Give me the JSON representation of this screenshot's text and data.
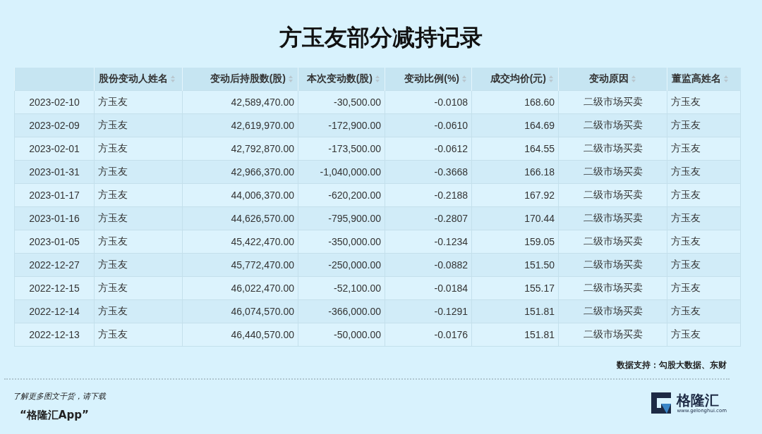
{
  "title": "方玉友部分减持记录",
  "table": {
    "columns": [
      "",
      "股份变动人姓名",
      "变动后持股数(股)",
      "本次变动数(股)",
      "变动比例(%)",
      "成交均价(元)",
      "变动原因",
      "董监高姓名"
    ],
    "rows": [
      [
        "2023-02-10",
        "方玉友",
        "42,589,470.00",
        "-30,500.00",
        "-0.0108",
        "168.60",
        "二级市场买卖",
        "方玉友"
      ],
      [
        "2023-02-09",
        "方玉友",
        "42,619,970.00",
        "-172,900.00",
        "-0.0610",
        "164.69",
        "二级市场买卖",
        "方玉友"
      ],
      [
        "2023-02-01",
        "方玉友",
        "42,792,870.00",
        "-173,500.00",
        "-0.0612",
        "164.55",
        "二级市场买卖",
        "方玉友"
      ],
      [
        "2023-01-31",
        "方玉友",
        "42,966,370.00",
        "-1,040,000.00",
        "-0.3668",
        "166.18",
        "二级市场买卖",
        "方玉友"
      ],
      [
        "2023-01-17",
        "方玉友",
        "44,006,370.00",
        "-620,200.00",
        "-0.2188",
        "167.92",
        "二级市场买卖",
        "方玉友"
      ],
      [
        "2023-01-16",
        "方玉友",
        "44,626,570.00",
        "-795,900.00",
        "-0.2807",
        "170.44",
        "二级市场买卖",
        "方玉友"
      ],
      [
        "2023-01-05",
        "方玉友",
        "45,422,470.00",
        "-350,000.00",
        "-0.1234",
        "159.05",
        "二级市场买卖",
        "方玉友"
      ],
      [
        "2022-12-27",
        "方玉友",
        "45,772,470.00",
        "-250,000.00",
        "-0.0882",
        "151.50",
        "二级市场买卖",
        "方玉友"
      ],
      [
        "2022-12-15",
        "方玉友",
        "46,022,470.00",
        "-52,100.00",
        "-0.0184",
        "155.17",
        "二级市场买卖",
        "方玉友"
      ],
      [
        "2022-12-14",
        "方玉友",
        "46,074,570.00",
        "-366,000.00",
        "-0.1291",
        "151.81",
        "二级市场买卖",
        "方玉友"
      ],
      [
        "2022-12-13",
        "方玉友",
        "46,440,570.00",
        "-50,000.00",
        "-0.0176",
        "151.81",
        "二级市场买卖",
        "方玉友"
      ]
    ]
  },
  "source": "数据支持：勾股大数据、东财",
  "promo": [
    "了解更多图文干货，请下载",
    "“格隆汇App”"
  ],
  "logo": {
    "name": "格隆汇",
    "url": "www.gelonghui.com"
  }
}
